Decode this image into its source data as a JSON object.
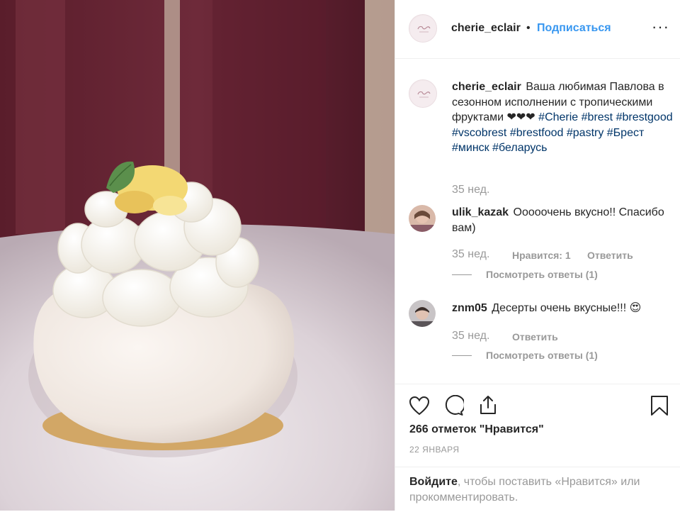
{
  "post": {
    "image_alt": "Pavlova dessert with whipped cream, pineapple and mint on a white plate",
    "username": "cherie_eclair",
    "separator": "•",
    "follow_label": "Подписаться",
    "more_label": "···"
  },
  "caption": {
    "username": "cherie_eclair",
    "text": "Ваша любимая Павлова в сезонном исполнении с тропическими фруктами ❤❤❤",
    "hashtags": "#Cherie #brest #brestgood #vscobrest #brestfood #pastry #Брест #минск #беларусь",
    "time": "35 нед."
  },
  "comments": [
    {
      "username": "ulik_kazak",
      "text": "Ооооочень вкусно!! Спасибо вам)",
      "time": "35 нед.",
      "likes_label": "Нравится: 1",
      "reply_label": "Ответить",
      "view_replies": "Посмотреть ответы (1)"
    },
    {
      "username": "znm05",
      "text": "Десерты очень вкусные!!! 😍",
      "time": "35 нед.",
      "reply_label": "Ответить",
      "view_replies": "Посмотреть ответы (1)"
    }
  ],
  "actions": {
    "likes_text": "266 отметок \"Нравится\"",
    "date": "22 ЯНВАРЯ"
  },
  "login_prompt": {
    "link": "Войдите",
    "text": ", чтобы поставить «Нравится» или прокомментировать."
  },
  "colors": {
    "link_blue": "#3897f0",
    "hashtag": "#003569",
    "muted": "#999999",
    "text": "#262626"
  }
}
